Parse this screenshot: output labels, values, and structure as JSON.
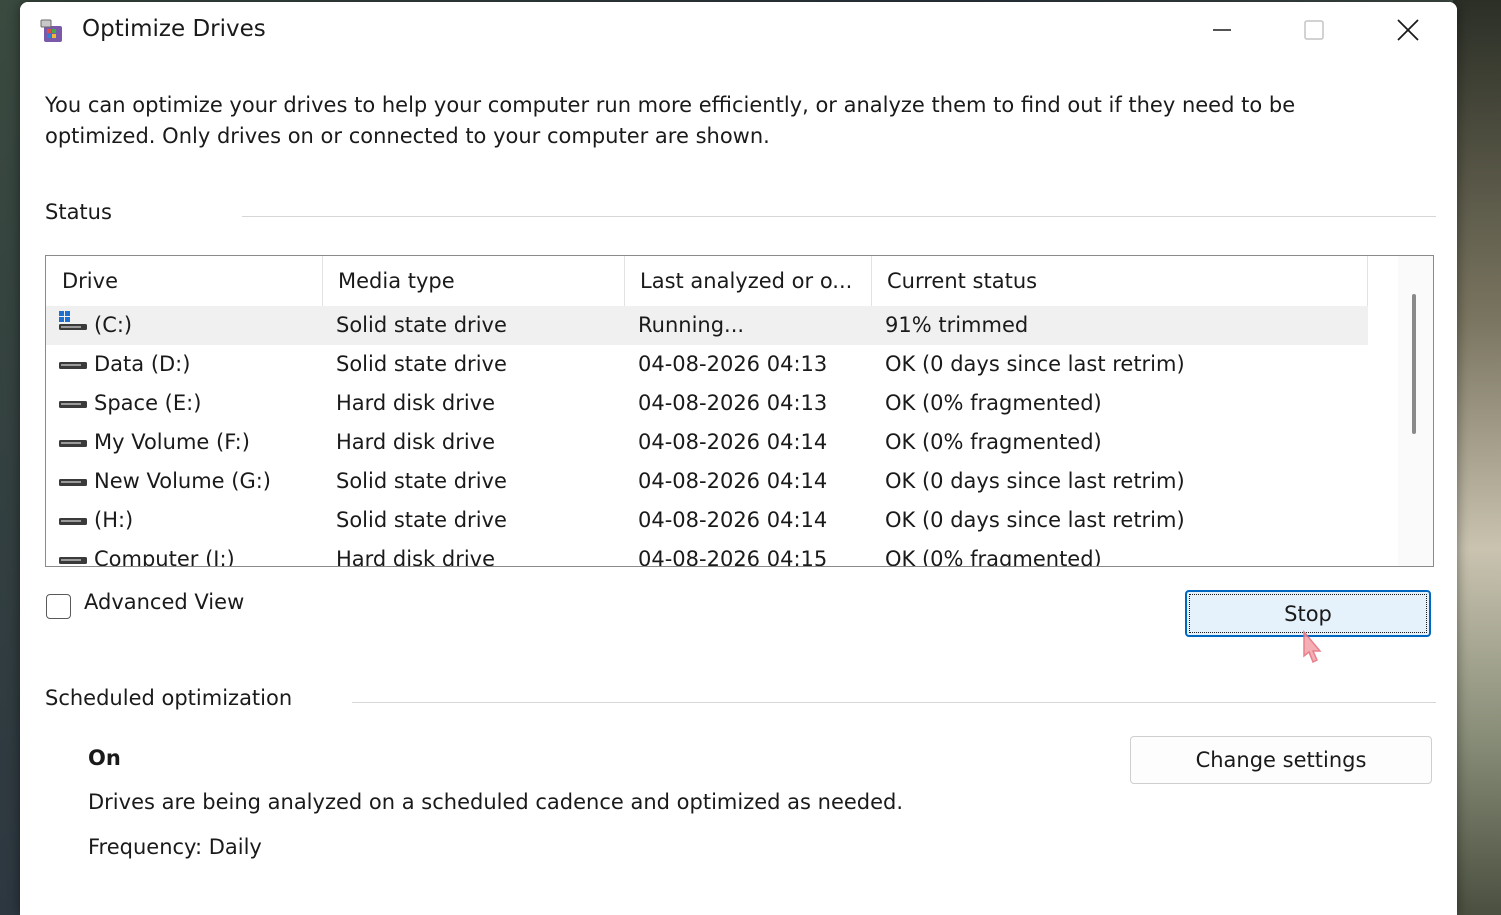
{
  "window": {
    "title": "Optimize Drives",
    "controls": {
      "minimize": "minimize-icon",
      "maximize": "maximize-icon",
      "close": "close-icon"
    }
  },
  "description": "You can optimize your drives to help your computer run more efficiently, or analyze them to find out if they need to be optimized. Only drives on or connected to your computer are shown.",
  "status": {
    "label": "Status",
    "columns": [
      "Drive",
      "Media type",
      "Last analyzed or o...",
      "Current status"
    ],
    "rows": [
      {
        "drive": "(C:)",
        "media": "Solid state drive",
        "last": "Running...",
        "status": "91% trimmed",
        "icon": "windows-drive-icon",
        "selected": true
      },
      {
        "drive": "Data (D:)",
        "media": "Solid state drive",
        "last": "04-08-2026 04:13",
        "status": "OK (0 days since last retrim)",
        "icon": "drive-icon"
      },
      {
        "drive": "Space (E:)",
        "media": "Hard disk drive",
        "last": "04-08-2026 04:13",
        "status": "OK (0% fragmented)",
        "icon": "drive-icon"
      },
      {
        "drive": "My Volume (F:)",
        "media": "Hard disk drive",
        "last": "04-08-2026 04:14",
        "status": "OK (0% fragmented)",
        "icon": "drive-icon"
      },
      {
        "drive": "New Volume (G:)",
        "media": "Solid state drive",
        "last": "04-08-2026 04:14",
        "status": "OK (0 days since last retrim)",
        "icon": "drive-icon"
      },
      {
        "drive": "(H:)",
        "media": "Solid state drive",
        "last": "04-08-2026 04:14",
        "status": "OK (0 days since last retrim)",
        "icon": "drive-icon"
      },
      {
        "drive": "Computer (I:)",
        "media": "Hard disk drive",
        "last": "04-08-2026 04:15",
        "status": "OK (0% fragmented)",
        "icon": "drive-icon"
      }
    ],
    "advanced_view_label": "Advanced View",
    "advanced_view_checked": false,
    "stop_label": "Stop"
  },
  "scheduled": {
    "label": "Scheduled optimization",
    "state": "On",
    "description": "Drives are being analyzed on a scheduled cadence and optimized as needed.",
    "frequency": "Frequency: Daily",
    "change_settings_label": "Change settings"
  },
  "colors": {
    "accent": "#0067c0",
    "selected_row": "#f0f0f0",
    "button_focus_bg": "#e5f1fb"
  }
}
